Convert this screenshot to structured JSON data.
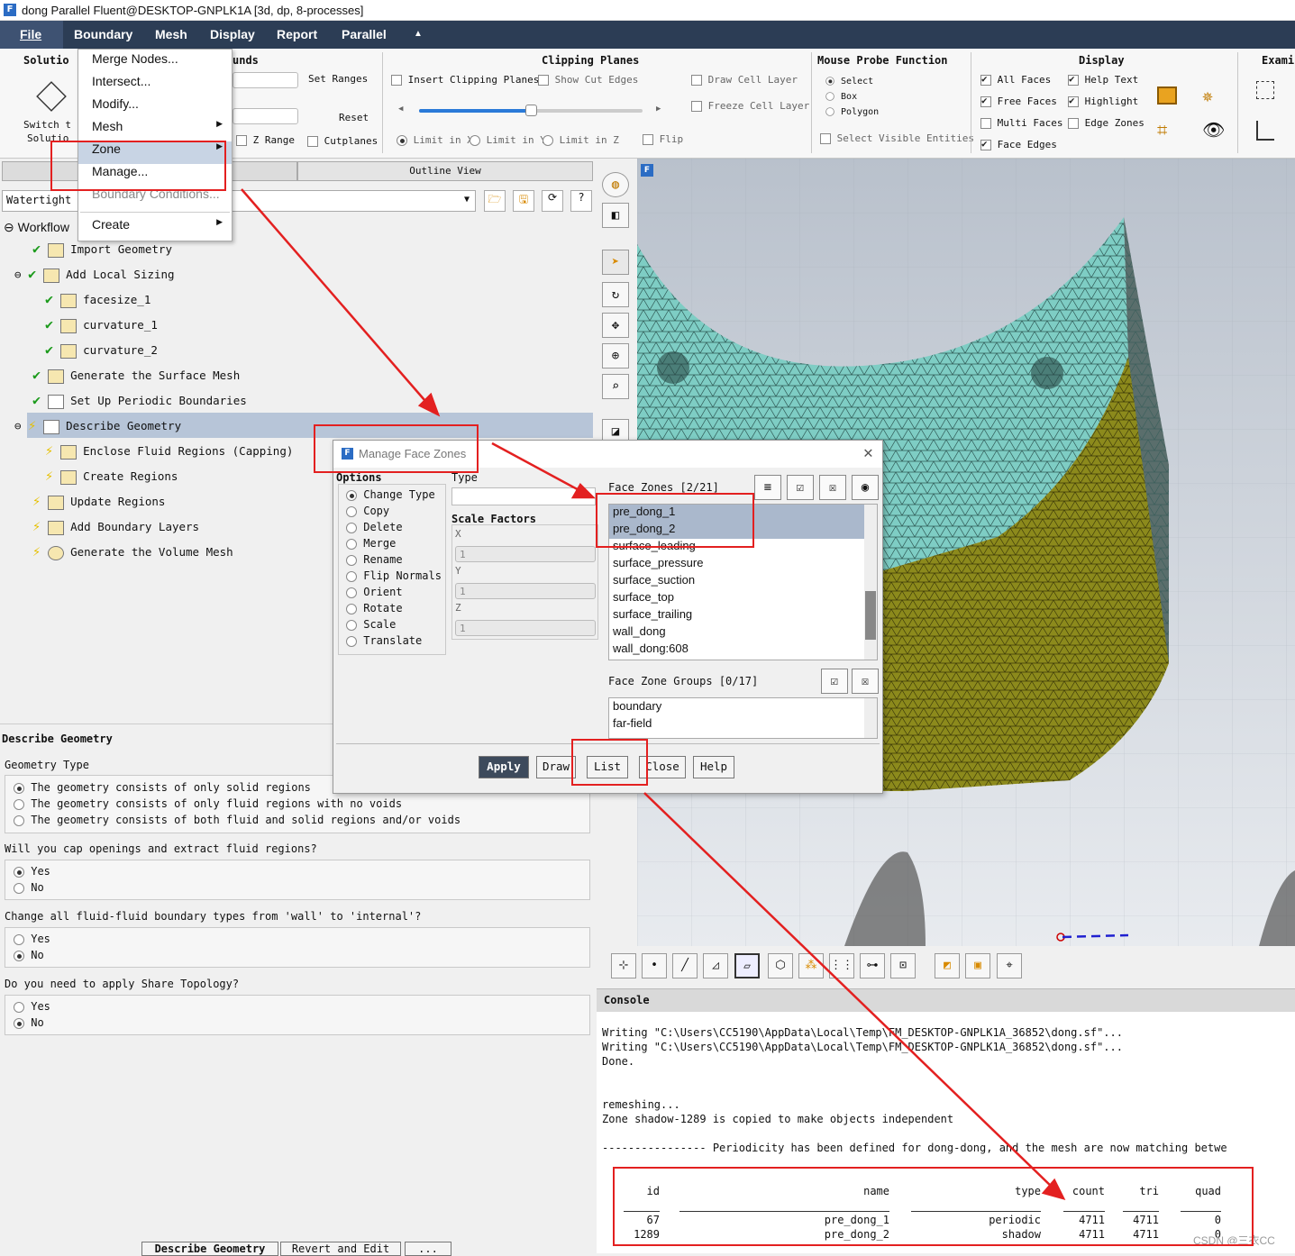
{
  "window": {
    "title": "dong Parallel Fluent@DESKTOP-GNPLK1A  [3d, dp, 8-processes]",
    "logo": "F"
  },
  "menubar": [
    "File",
    "Boundary",
    "Mesh",
    "Display",
    "Report",
    "Parallel"
  ],
  "ribbon": {
    "solution": {
      "title": "Solutio",
      "switch_l1": "Switch t",
      "switch_l2": "Solutio"
    },
    "bounds": {
      "title": "unds",
      "set_ranges": "Set Ranges",
      "reset": "Reset",
      "z_range": "Z Range",
      "cutplanes": "Cutplanes"
    },
    "clipping": {
      "title": "Clipping Planes",
      "insert": "Insert Clipping Planes",
      "show_cut": "Show Cut Edges",
      "draw_cell": "Draw Cell Layer",
      "freeze_cell": "Freeze Cell Layer",
      "limit_x": "Limit in X",
      "limit_y": "Limit in Y",
      "limit_z": "Limit in Z",
      "flip": "Flip"
    },
    "probe": {
      "title": "Mouse Probe Function",
      "select": "Select",
      "box": "Box",
      "polygon": "Polygon",
      "visible": "Select Visible Entities"
    },
    "display": {
      "title": "Display",
      "all_faces": "All Faces",
      "free_faces": "Free Faces",
      "multi_faces": "Multi Faces",
      "face_edges": "Face Edges",
      "help_text": "Help Text",
      "highlight": "Highlight",
      "edge_zones": "Edge Zones"
    },
    "examine": {
      "title": "Exami"
    }
  },
  "zone_menu": {
    "items": [
      "Merge Nodes...",
      "Intersect...",
      "Modify...",
      "Mesh",
      "Zone",
      "Manage...",
      "Boundary Conditions...",
      "Create"
    ]
  },
  "left": {
    "tab_outline": "Outline View",
    "workflow_select": "Watertight",
    "workflow_label": "Workflow",
    "tree": [
      "Import Geometry",
      "Add Local Sizing",
      "facesize_1",
      "curvature_1",
      "curvature_2",
      "Generate the Surface Mesh",
      "Set Up Periodic Boundaries",
      "Describe Geometry",
      "Enclose Fluid Regions (Capping)",
      "Create Regions",
      "Update Regions",
      "Add Boundary Layers",
      "Generate the Volume Mesh"
    ],
    "panel_title": "Describe Geometry",
    "geom_type_label": "Geometry Type",
    "geom_opts": [
      "The geometry consists of only solid regions",
      "The geometry consists of only fluid regions with no voids",
      "The geometry consists of both fluid and solid regions and/or voids"
    ],
    "q_cap": "Will you cap openings and extract fluid regions?",
    "q_change": "Change all fluid-fluid boundary types from 'wall' to 'internal'?",
    "q_share": "Do you need to apply Share Topology?",
    "yes": "Yes",
    "no": "No",
    "bottom_buttons": [
      "Describe Geometry",
      "Revert and Edit",
      "..."
    ]
  },
  "dialog": {
    "title": "Manage Face Zones",
    "options_label": "Options",
    "options": [
      "Change Type",
      "Copy",
      "Delete",
      "Merge",
      "Rename",
      "Flip Normals",
      "Orient",
      "Rotate",
      "Scale",
      "Translate"
    ],
    "type_label": "Type",
    "scale_label": "Scale Factors",
    "x": "X",
    "y": "Y",
    "z": "Z",
    "sx": "1",
    "sy": "1",
    "sz": "1",
    "face_zones_label": "Face Zones [2/21]",
    "face_zones": [
      "pre_dong_1",
      "pre_dong_2",
      "surface_leading",
      "surface_pressure",
      "surface_suction",
      "surface_top",
      "surface_trailing",
      "wall_dong",
      "wall_dong:608"
    ],
    "groups_label": "Face Zone Groups [0/17]",
    "groups": [
      "boundary",
      "far-field"
    ],
    "buttons": [
      "Apply",
      "Draw",
      "List",
      "Close",
      "Help"
    ]
  },
  "console": {
    "title": "Console",
    "lines": [
      "Writing \"C:\\Users\\CC5190\\AppData\\Local\\Temp\\FM_DESKTOP-GNPLK1A_36852\\dong.sf\"...",
      "Writing \"C:\\Users\\CC5190\\AppData\\Local\\Temp\\FM_DESKTOP-GNPLK1A_36852\\dong.sf\"...",
      "Done.",
      "",
      "",
      "remeshing...",
      "Zone shadow-1289 is copied to make objects independent",
      "",
      "---------------- Periodicity has been defined for dong-dong, and the mesh are now matching betwe"
    ],
    "table": {
      "headers": [
        "id",
        "name",
        "type",
        "count",
        "tri",
        "quad"
      ],
      "rows": [
        [
          "67",
          "pre_dong_1",
          "periodic",
          "4711",
          "4711",
          "0"
        ],
        [
          "1289",
          "pre_dong_2",
          "shadow",
          "4711",
          "4711",
          "0"
        ]
      ]
    }
  },
  "watermark": "CSDN @三衣CC",
  "colors": {
    "menubar": "#2c3d55",
    "highlight": "#e32020",
    "mesh_top": "#7ecdc4",
    "mesh_side": "#8c8a1c"
  }
}
